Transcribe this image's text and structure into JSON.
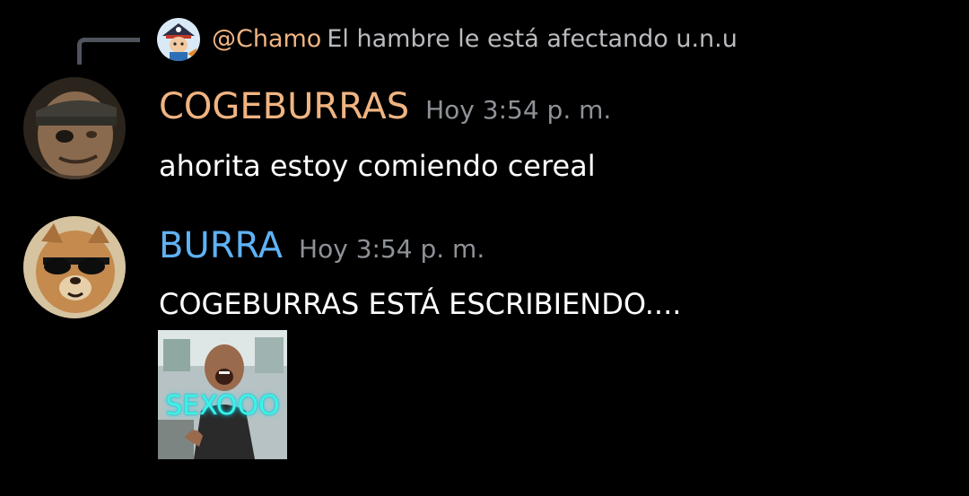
{
  "colors": {
    "background": "#000000",
    "reply_line": "#4f545c",
    "name_cogeburras": "#f0b482",
    "name_burra": "#5eb2f5",
    "timestamp": "#8e9297",
    "message_text": "#ffffff",
    "reply_text": "#b9bbbe",
    "gif_caption": "#39f5e6"
  },
  "reply": {
    "avatar_icon": "pirate-avatar-icon",
    "mention": "@Chamo",
    "text": "El hambre le está afectando u.n.u"
  },
  "messages": [
    {
      "avatar_icon": "soldier-avatar-icon",
      "author": "COGEBURRAS",
      "timestamp": "Hoy 3:54 p. m.",
      "text": "ahorita estoy comiendo cereal"
    },
    {
      "avatar_icon": "dog-sunglasses-avatar-icon",
      "author": "BURRA",
      "timestamp": "Hoy 3:54 p. m.",
      "text": "COGEBURRAS ESTÁ ESCRIBIENDO....",
      "attachment": {
        "type": "gif-image",
        "caption": "SEXOOO"
      }
    }
  ]
}
